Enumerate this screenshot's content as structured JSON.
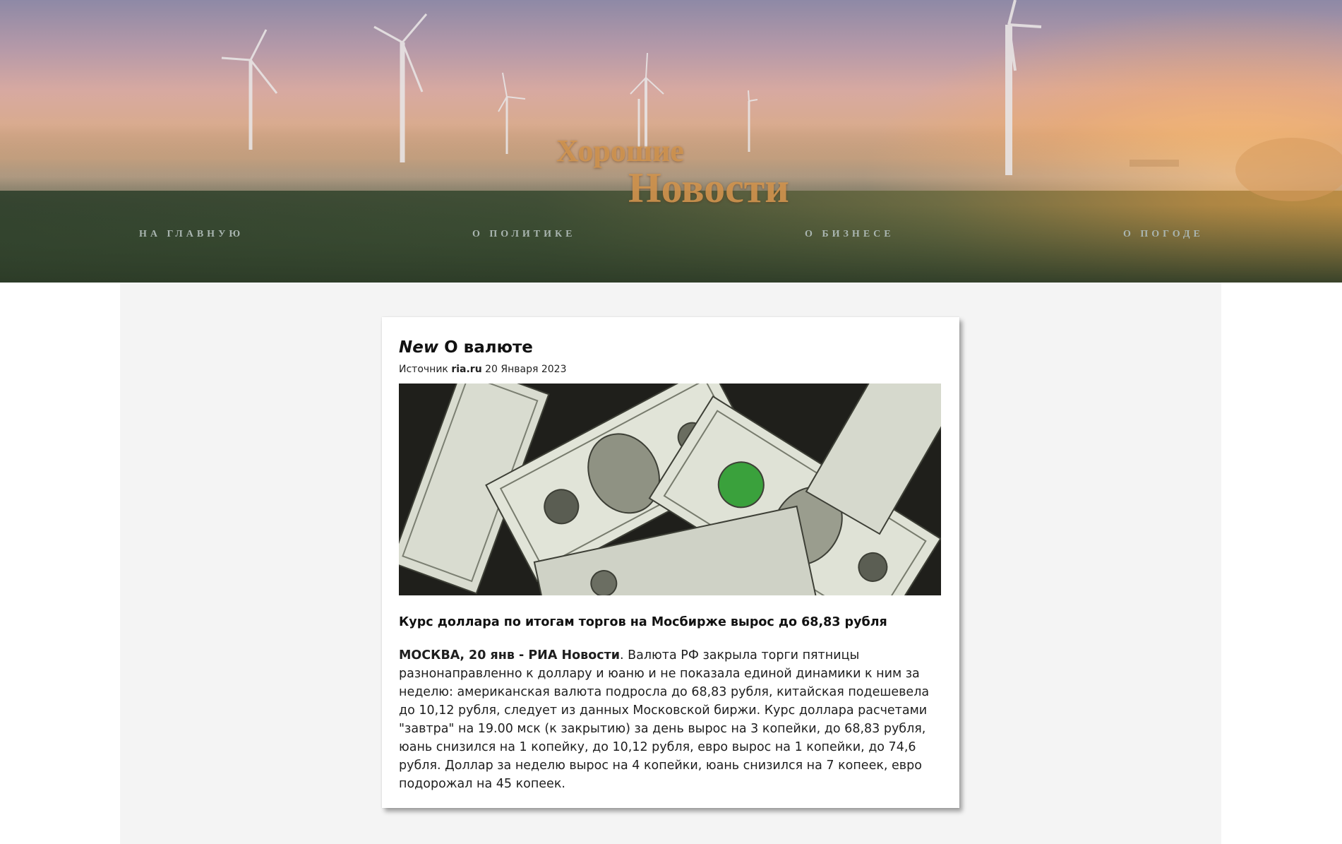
{
  "header": {
    "logo_line1": "Хорошие",
    "logo_line2": "Новости",
    "nav": [
      {
        "label": "НА ГЛАВНУЮ"
      },
      {
        "label": "О ПОЛИТИКЕ"
      },
      {
        "label": "О БИЗНЕСЕ"
      },
      {
        "label": "О ПОГОДЕ"
      }
    ]
  },
  "article": {
    "new_tag": "New",
    "title": "О валюте",
    "source_label": "Источник",
    "source_name": "ria.ru",
    "date": "20 Января 2023",
    "image_icon": "dollar-banknotes-image",
    "headline": "Курс доллара по итогам торгов на Мосбирже вырос до 68,83 рубля",
    "lead": "МОСКВА, 20 янв - РИА Новости",
    "body": ". Валюта РФ закрыла торги пятницы разнонаправленно к доллару и юаню и не показала единой динамики к ним за неделю: американская валюта подросла до 68,83 рубля, китайская подешевела до 10,12 рубля, следует из данных Московской биржи. Курс доллара расчетами \"завтра\" на 19.00 мск (к закрытию) за день вырос на 3 копейки, до 68,83 рубля, юань снизился на 1 копейку, до 10,12 рубля, евро вырос на 1 копейки, до 74,6 рубля. Доллар за неделю вырос на 4 копейки, юань снизился на 7 копеек, евро подорожал на 45 копеек."
  },
  "colors": {
    "nav_text": "#a9b5b0",
    "logo_text": "#d49650",
    "content_bg": "#f4f4f4",
    "card_bg": "#ffffff"
  }
}
